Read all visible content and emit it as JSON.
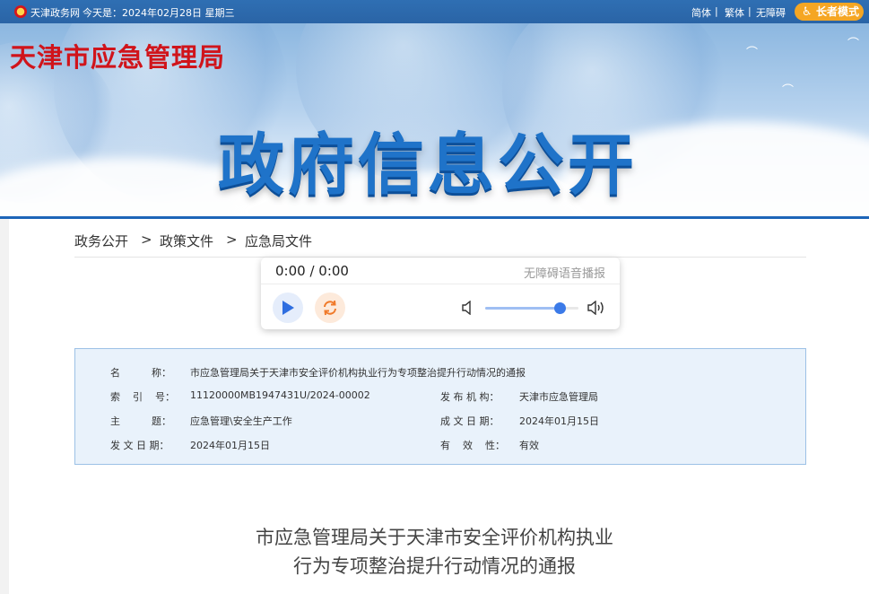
{
  "topbar": {
    "site_name": "天津政务网",
    "date_text": "今天是：2024年02月28日 星期三",
    "simplified": "简体",
    "separator": "|",
    "traditional": "繁体",
    "accessibility": "无障碍",
    "elder_mode": "长者模式"
  },
  "banner": {
    "bureau_name": "天津市应急管理局",
    "section_title": "政府信息公开"
  },
  "breadcrumb": {
    "items": [
      "政务公开",
      "政策文件",
      "应急局文件"
    ],
    "separator": ">"
  },
  "player": {
    "time": "0:00 / 0:00",
    "label": "无障碍语音播报",
    "volume": 0.8
  },
  "meta": {
    "name_label": "名          称：",
    "name_value": "市应急管理局关于天津市安全评价机构执业行为专项整治提升行动情况的通报",
    "index_label": "索    引    号：",
    "index_value": "11120000MB1947431U/2024-00002",
    "publisher_label": "发 布 机 构：",
    "publisher_value": "天津市应急管理局",
    "topic_label": "主          题：",
    "topic_value": "应急管理\\安全生产工作",
    "created_label": "成 文 日 期：",
    "created_value": "2024年01月15日",
    "issued_label": "发 文 日 期：",
    "issued_value": "2024年01月15日",
    "valid_label": "有    效    性：",
    "valid_value": "有效"
  },
  "article": {
    "title_line1": "市应急管理局关于天津市安全评价机构执业",
    "title_line2": "行为专项整治提升行动情况的通报"
  },
  "colors": {
    "topbar": "#2f6fb3",
    "accent_blue": "#1c65b8",
    "bureau_red": "#d0141b",
    "elder_orange": "#f5a623",
    "meta_bg": "#e9f2fb"
  }
}
